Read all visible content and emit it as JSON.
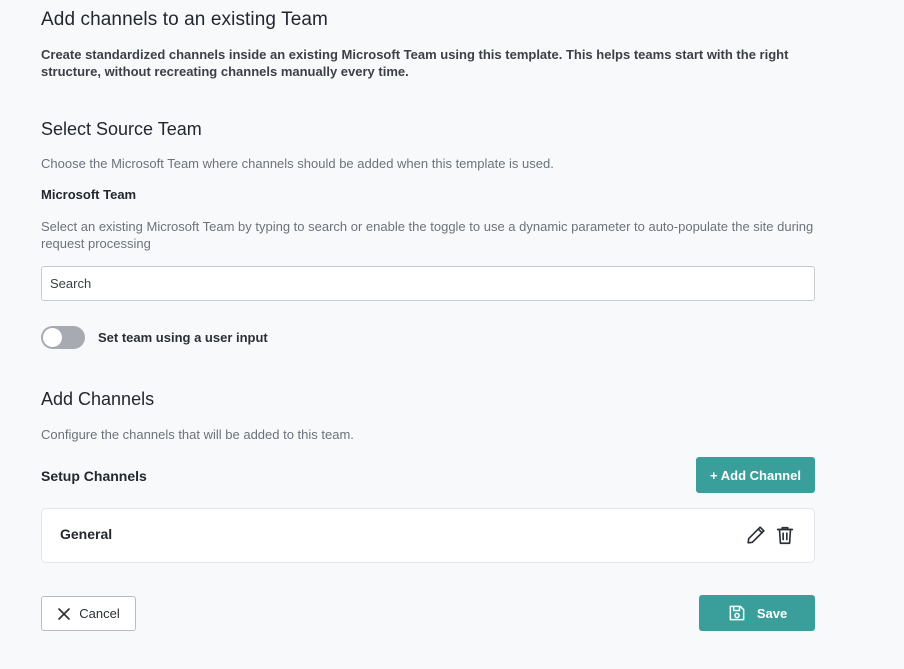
{
  "header": {
    "title": "Add channels to an existing Team",
    "description": "Create standardized channels inside an existing Microsoft Team using this template. This helps teams start with the right structure, without recreating channels manually every time."
  },
  "source_team": {
    "heading": "Select Source Team",
    "description": "Choose the Microsoft Team where channels should be added when this template is used.",
    "field_label": "Microsoft Team",
    "field_help": "Select an existing Microsoft Team by typing to search or enable the toggle to use a dynamic parameter to auto-populate the site during request processing",
    "search_placeholder": "Search",
    "toggle_label": "Set team using a user input",
    "toggle_on": false
  },
  "channels": {
    "heading": "Add Channels",
    "description": "Configure the channels that will be added to this team.",
    "setup_label": "Setup Channels",
    "add_button_label": "+ Add Channel",
    "items": [
      {
        "name": "General"
      }
    ]
  },
  "footer": {
    "cancel_label": "Cancel",
    "save_label": "Save"
  },
  "colors": {
    "accent": "#3a9e9a",
    "toggle_off": "#a7abb1"
  }
}
